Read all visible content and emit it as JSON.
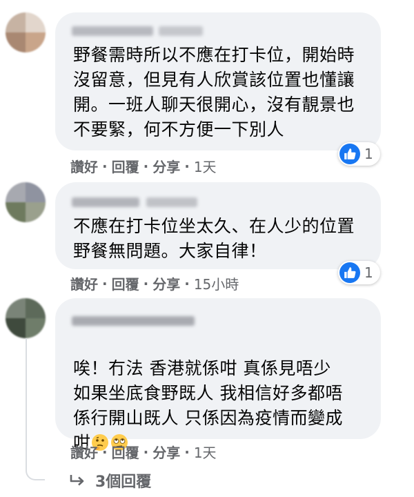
{
  "comments": [
    {
      "text": "野餐需時所以不應在打卡位，開始時\n沒留意，但見有人欣賞該位置也懂讓\n開。一班人聊天很開心，沒有靚景也\n不要緊，何不方便一下別人",
      "reaction_count": "1",
      "actions": {
        "like": "讚好",
        "reply": "回覆",
        "share": "分享",
        "time": "1天"
      }
    },
    {
      "text": "不應在打卡位坐太久、在人少的位置\n野餐無問題。大家自律！",
      "reaction_count": "1",
      "actions": {
        "like": "讚好",
        "reply": "回覆",
        "share": "分享",
        "time": "15小時"
      }
    },
    {
      "text": "唉！冇法 香港就係咁 真係見唔少\n如果坐底食野既人 我相信好多都唔\n係行開山既人 只係因為疫情而變成\n咁",
      "emojis": [
        "thinking-face-icon",
        "eye-roll-face-icon"
      ],
      "actions": {
        "like": "讚好",
        "reply": "回覆",
        "share": "分享",
        "time": "1天"
      }
    }
  ],
  "replies_link": {
    "label": "3個回覆"
  },
  "colors": {
    "bubble": "#f0f2f5",
    "text": "#050505",
    "secondary": "#65676b",
    "like_blue": "#1877f2"
  }
}
